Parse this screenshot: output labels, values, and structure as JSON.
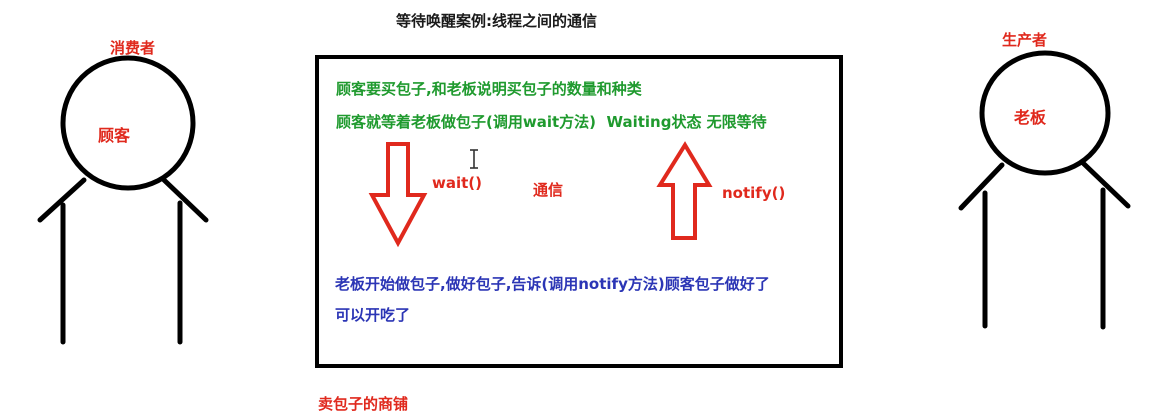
{
  "title": "等待唤醒案例:线程之间的通信",
  "consumer": {
    "role_label": "消费者",
    "name_label": "顾客"
  },
  "producer": {
    "role_label": "生产者",
    "name_label": "老板"
  },
  "shop_label": "卖包子的商铺",
  "steps": {
    "line1": "顾客要买包子,和老板说明买包子的数量和种类",
    "line2": "顾客就等着老板做包子(调用wait方法)  Waiting状态 无限等待",
    "line3": "老板开始做包子,做好包子,告诉(调用notify方法)顾客包子做好了",
    "line4": "可以开吃了"
  },
  "arrows": {
    "wait_label": "wait()",
    "comm_label": "通信",
    "notify_label": "notify()"
  },
  "colors": {
    "red": "#e0291d",
    "green": "#1f9a2e",
    "blue": "#2b35b5",
    "black": "#000000"
  }
}
